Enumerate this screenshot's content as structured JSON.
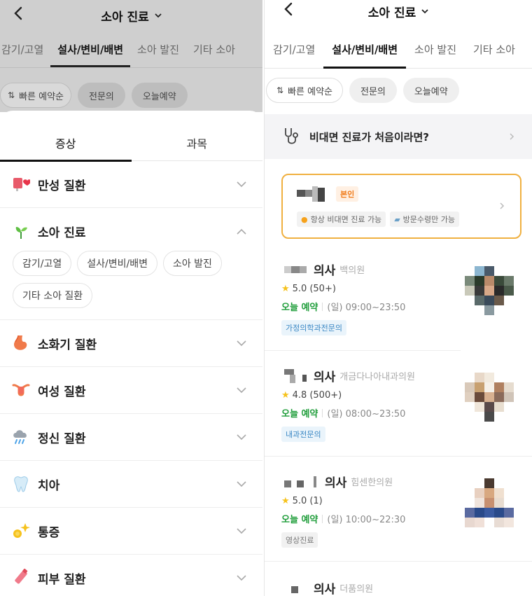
{
  "header": {
    "title": "소아 진료"
  },
  "tabs": [
    "감기/고열",
    "설사/변비/배변",
    "소아 발진",
    "기타 소아"
  ],
  "filters": {
    "sort": "빠른 예약순",
    "chip1": "전문의",
    "chip2": "오늘예약"
  },
  "sheet": {
    "tab_symptom": "증상",
    "tab_department": "과목",
    "categories": [
      {
        "label": "만성 질환",
        "icon": "chronic-disease-icon"
      },
      {
        "label": "소아 진료",
        "icon": "sprout-icon"
      },
      {
        "label": "소화기 질환",
        "icon": "stomach-icon"
      },
      {
        "label": "여성 질환",
        "icon": "uterus-icon"
      },
      {
        "label": "정신 질환",
        "icon": "rain-cloud-icon"
      },
      {
        "label": "치아",
        "icon": "tooth-icon"
      },
      {
        "label": "통증",
        "icon": "sparkle-pain-icon"
      },
      {
        "label": "피부 질환",
        "icon": "skin-ointment-icon"
      }
    ],
    "pediatric_sub": [
      "감기/고열",
      "설사/변비/배변",
      "소아 발진",
      "기타 소아 질환"
    ]
  },
  "right": {
    "notice": "비대면 진료가 처음이라면?",
    "profile": {
      "badge": "본인",
      "pill1": "항상 비대면 진료 가능",
      "pill2": "방문수령만 가능"
    },
    "doctors": [
      {
        "name": "의사",
        "hospital": "백의원",
        "rating": "5.0",
        "reviews": "(50+)",
        "today": "오늘 예약",
        "hours": "(일) 09:00~23:50",
        "specialty": "가정의학과전문의",
        "spec_style": "blue"
      },
      {
        "name": "의사",
        "hospital": "개금다나아내과의원",
        "rating": "4.8",
        "reviews": "(500+)",
        "today": "오늘 예약",
        "hours": "(일) 08:00~23:50",
        "specialty": "내과전문의",
        "spec_style": "blue"
      },
      {
        "name": "의사",
        "hospital": "힘센한의원",
        "rating": "5.0",
        "reviews": "(1)",
        "today": "오늘 예약",
        "hours": "(일) 10:00~22:30",
        "specialty": "영상진료",
        "spec_style": "gray"
      },
      {
        "name": "의사",
        "hospital": "더품의원"
      }
    ]
  },
  "colors": {
    "accent_orange": "#f0b040",
    "today_green": "#1f9d3a",
    "badge_orange": "#f07a18"
  }
}
